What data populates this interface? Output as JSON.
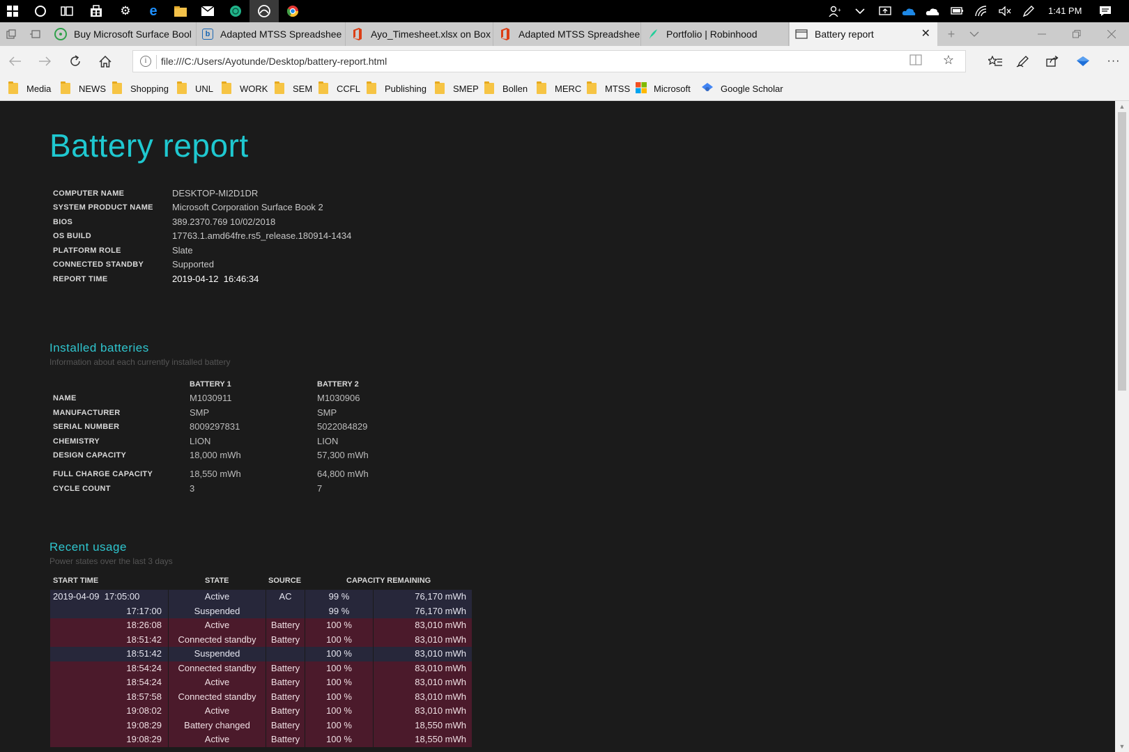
{
  "taskbar": {
    "icons": [
      "windows-start",
      "cortana-search",
      "task-view",
      "store",
      "settings",
      "edge",
      "file-explorer",
      "mail",
      "app-green",
      "app-browser-active",
      "chrome"
    ],
    "tray_icons": [
      "people",
      "chevron-up",
      "display",
      "onedrive-blue",
      "onedrive-white",
      "battery",
      "wifi",
      "volume-muted",
      "pen"
    ],
    "time": "1:41 PM"
  },
  "tabs": [
    {
      "label": "Buy Microsoft Surface Bool",
      "icon": "surface-icon",
      "color": "#2fa14a"
    },
    {
      "label": "Adapted MTSS Spreadshee",
      "icon": "box-icon",
      "color": "#1a67b3"
    },
    {
      "label": "Ayo_Timesheet.xlsx on Box",
      "icon": "office-icon",
      "color": "#dc3e15"
    },
    {
      "label": "Adapted MTSS Spreadshee",
      "icon": "office-icon",
      "color": "#dc3e15"
    },
    {
      "label": "Portfolio | Robinhood",
      "icon": "robinhood-icon",
      "color": "#21ce99"
    },
    {
      "label": "Battery report",
      "icon": "page-icon",
      "color": "#444444"
    }
  ],
  "address": {
    "url": "file:///C:/Users/Ayotunde/Desktop/battery-report.html"
  },
  "favorites": [
    "Media",
    "NEWS",
    "Shopping",
    "UNL",
    "WORK",
    "SEM",
    "CCFL",
    "Publishing",
    "SMEP",
    "Bollen",
    "MERC",
    "MTSS",
    "Microsoft",
    "Google Scholar"
  ],
  "report": {
    "title": "Battery report",
    "system": [
      {
        "label": "COMPUTER NAME",
        "value": "DESKTOP-MI2D1DR"
      },
      {
        "label": "SYSTEM PRODUCT NAME",
        "value": "Microsoft Corporation Surface Book 2"
      },
      {
        "label": "BIOS",
        "value": "389.2370.769 10/02/2018"
      },
      {
        "label": "OS BUILD",
        "value": "17763.1.amd64fre.rs5_release.180914-1434"
      },
      {
        "label": "PLATFORM ROLE",
        "value": "Slate"
      },
      {
        "label": "CONNECTED STANDBY",
        "value": "Supported"
      },
      {
        "label": "REPORT TIME",
        "value": "2019-04-12  16:46:34"
      }
    ],
    "installed": {
      "heading": "Installed batteries",
      "subheading": "Information about each currently installed battery",
      "columns": [
        "BATTERY 1",
        "BATTERY 2"
      ],
      "rows": [
        {
          "label": "NAME",
          "values": [
            "M1030911",
            "M1030906"
          ]
        },
        {
          "label": "MANUFACTURER",
          "values": [
            "SMP",
            "SMP"
          ]
        },
        {
          "label": "SERIAL NUMBER",
          "values": [
            "8009297831",
            "5022084829"
          ]
        },
        {
          "label": "CHEMISTRY",
          "values": [
            "LION",
            "LION"
          ]
        },
        {
          "label": "DESIGN CAPACITY",
          "values": [
            "18,000 mWh",
            "57,300 mWh"
          ]
        },
        {
          "label": "FULL CHARGE CAPACITY",
          "values": [
            "18,550 mWh",
            "64,800 mWh"
          ]
        },
        {
          "label": "CYCLE COUNT",
          "values": [
            "3",
            "7"
          ]
        }
      ]
    },
    "usage": {
      "heading": "Recent usage",
      "subheading": "Power states over the last 3 days",
      "columns": [
        "START TIME",
        "STATE",
        "SOURCE",
        "CAPACITY REMAINING"
      ],
      "rows": [
        {
          "time": "2019-04-09  17:05:00",
          "state": "Active",
          "source": "AC",
          "pct": "99 %",
          "cap": "76,170 mWh",
          "kind": "ac"
        },
        {
          "time": "17:17:00",
          "state": "Suspended",
          "source": "",
          "pct": "99 %",
          "cap": "76,170 mWh",
          "kind": "ac"
        },
        {
          "time": "18:26:08",
          "state": "Active",
          "source": "Battery",
          "pct": "100 %",
          "cap": "83,010 mWh",
          "kind": "bat"
        },
        {
          "time": "18:51:42",
          "state": "Connected standby",
          "source": "Battery",
          "pct": "100 %",
          "cap": "83,010 mWh",
          "kind": "bat"
        },
        {
          "time": "18:51:42",
          "state": "Suspended",
          "source": "",
          "pct": "100 %",
          "cap": "83,010 mWh",
          "kind": "ac"
        },
        {
          "time": "18:54:24",
          "state": "Connected standby",
          "source": "Battery",
          "pct": "100 %",
          "cap": "83,010 mWh",
          "kind": "bat"
        },
        {
          "time": "18:54:24",
          "state": "Active",
          "source": "Battery",
          "pct": "100 %",
          "cap": "83,010 mWh",
          "kind": "bat"
        },
        {
          "time": "18:57:58",
          "state": "Connected standby",
          "source": "Battery",
          "pct": "100 %",
          "cap": "83,010 mWh",
          "kind": "bat"
        },
        {
          "time": "19:08:02",
          "state": "Active",
          "source": "Battery",
          "pct": "100 %",
          "cap": "83,010 mWh",
          "kind": "bat"
        },
        {
          "time": "19:08:29",
          "state": "Battery changed",
          "source": "Battery",
          "pct": "100 %",
          "cap": "18,550 mWh",
          "kind": "bat"
        },
        {
          "time": "19:08:29",
          "state": "Active",
          "source": "Battery",
          "pct": "100 %",
          "cap": "18,550 mWh",
          "kind": "bat"
        }
      ]
    }
  }
}
